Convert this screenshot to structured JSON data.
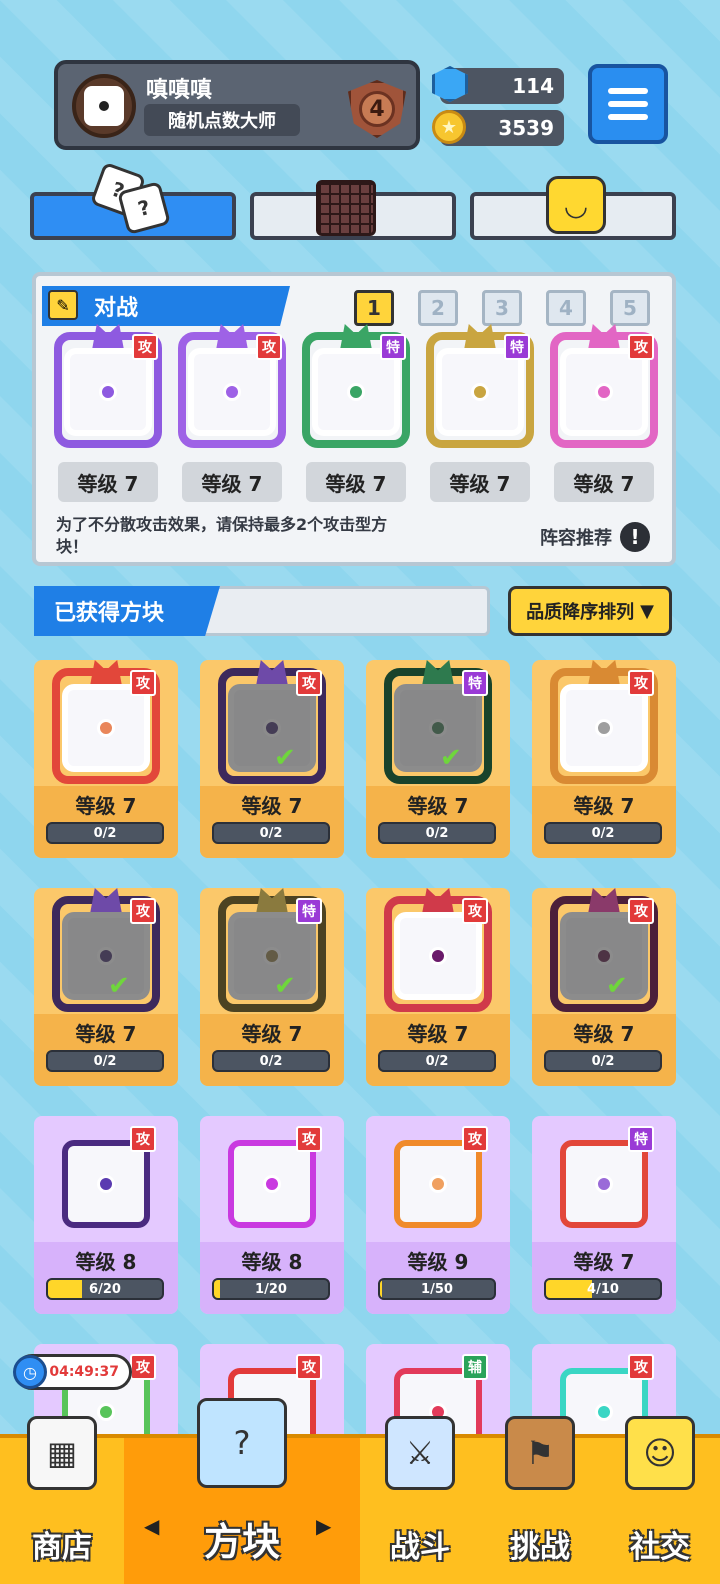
{
  "profile": {
    "name": "嗔嗔嗔",
    "title": "随机点数大师",
    "rank": "4"
  },
  "currency": {
    "gems": "114",
    "coins": "3539"
  },
  "top_tabs": [
    {
      "name": "dice"
    },
    {
      "name": "board"
    },
    {
      "name": "emote"
    }
  ],
  "battle": {
    "label": "对战",
    "decks": [
      "1",
      "2",
      "3",
      "4",
      "5"
    ],
    "selected_deck": "1",
    "slots": [
      {
        "level": "等级 7",
        "badge": "攻",
        "color": "#8e5ae0"
      },
      {
        "level": "等级 7",
        "badge": "攻",
        "color": "#9e62e6"
      },
      {
        "level": "等级 7",
        "badge": "特",
        "color": "#3aa565"
      },
      {
        "level": "等级 7",
        "badge": "特",
        "color": "#c9a540"
      },
      {
        "level": "等级 7",
        "badge": "攻",
        "color": "#e266c4"
      }
    ],
    "tip": "为了不分散攻击效果，请保持最多2个攻击型方块！",
    "recommend": "阵容推荐"
  },
  "owned": {
    "label": "已获得方块",
    "sort": "品质降序排列"
  },
  "cards": [
    {
      "level": "等级 7",
      "progress": "0/2",
      "fill": 0,
      "badge": "攻",
      "color": "#e2473a",
      "dot": "#e9865a",
      "tier": "legend",
      "grayed": false
    },
    {
      "level": "等级 7",
      "progress": "0/2",
      "fill": 0,
      "badge": "攻",
      "color": "#6e4aa8",
      "dot": "#8a62d8",
      "tier": "legend",
      "grayed": true
    },
    {
      "level": "等级 7",
      "progress": "0/2",
      "fill": 0,
      "badge": "特",
      "color": "#2e7a4e",
      "dot": "#46b56b",
      "tier": "legend",
      "grayed": true
    },
    {
      "level": "等级 7",
      "progress": "0/2",
      "fill": 0,
      "badge": "攻",
      "color": "#d98a33",
      "dot": "#9e9e9e",
      "tier": "legend",
      "grayed": false
    },
    {
      "level": "等级 7",
      "progress": "0/2",
      "fill": 0,
      "badge": "攻",
      "color": "#6e4aa8",
      "dot": "#8a62d8",
      "tier": "legend",
      "grayed": true
    },
    {
      "level": "等级 7",
      "progress": "0/2",
      "fill": 0,
      "badge": "特",
      "color": "#8a7a3e",
      "dot": "#c9a540",
      "tier": "legend",
      "grayed": true
    },
    {
      "level": "等级 7",
      "progress": "0/2",
      "fill": 0,
      "badge": "攻",
      "color": "#d03a4a",
      "dot": "#6a1a6a",
      "tier": "legend",
      "grayed": false
    },
    {
      "level": "等级 7",
      "progress": "0/2",
      "fill": 0,
      "badge": "攻",
      "color": "#8a3a6a",
      "dot": "#c04a9a",
      "tier": "legend",
      "grayed": true
    },
    {
      "level": "等级 8",
      "progress": "6/20",
      "fill": 0.3,
      "badge": "攻",
      "color": "#4a2a80",
      "dot": "#5a3ab0",
      "tier": "epic",
      "grayed": false
    },
    {
      "level": "等级 8",
      "progress": "1/20",
      "fill": 0.05,
      "badge": "攻",
      "color": "#c93ae0",
      "dot": "#c93ae0",
      "tier": "epic",
      "grayed": false
    },
    {
      "level": "等级 9",
      "progress": "1/50",
      "fill": 0.02,
      "badge": "攻",
      "color": "#f08a2a",
      "dot": "#f0a060",
      "tier": "epic",
      "grayed": false
    },
    {
      "level": "等级 7",
      "progress": "4/10",
      "fill": 0.4,
      "badge": "特",
      "color": "#e2473a",
      "dot": "#9a6ad8",
      "tier": "epic",
      "grayed": false
    },
    {
      "level": "",
      "progress": "",
      "fill": 0,
      "badge": "攻",
      "color": "#58c45a",
      "dot": "#58c45a",
      "tier": "epic",
      "grayed": false
    },
    {
      "level": "",
      "progress": "",
      "fill": 0,
      "badge": "攻",
      "color": "#e23a3a",
      "dot": "#e23a3a",
      "tier": "epic",
      "grayed": false
    },
    {
      "level": "",
      "progress": "",
      "fill": 0,
      "badge": "辅",
      "color": "#e23a5a",
      "dot": "#e23a5a",
      "tier": "epic",
      "grayed": false
    },
    {
      "level": "",
      "progress": "",
      "fill": 0,
      "badge": "攻",
      "color": "#3ad6c4",
      "dot": "#3ad6c4",
      "tier": "epic",
      "grayed": false
    }
  ],
  "timer": "04:49:37",
  "nav": [
    {
      "label": "商店",
      "icon": "shop-icon"
    },
    {
      "label": "方块",
      "icon": "dice-cube-icon"
    },
    {
      "label": "战斗",
      "icon": "battle-icon"
    },
    {
      "label": "挑战",
      "icon": "challenge-icon"
    },
    {
      "label": "社交",
      "icon": "social-icon"
    }
  ]
}
